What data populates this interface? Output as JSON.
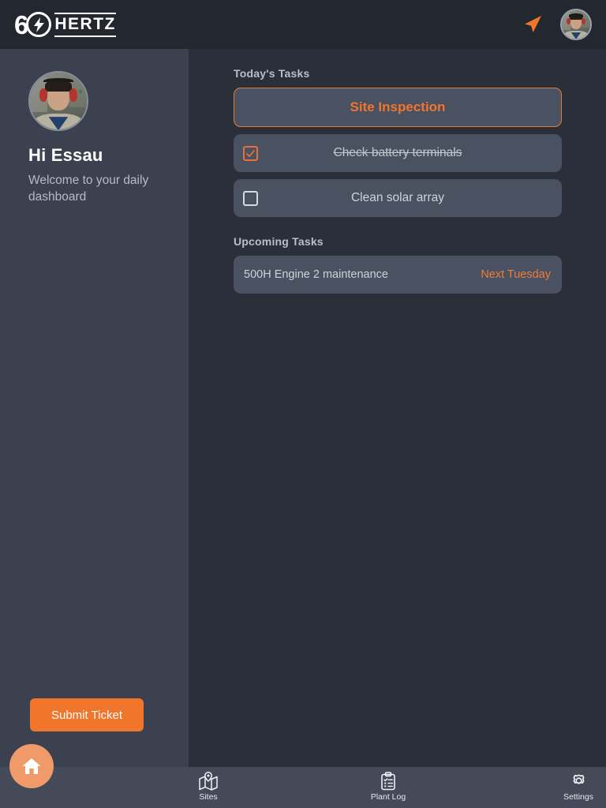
{
  "header": {
    "logo": {
      "six": "6",
      "word": "HERTZ",
      "bolt_icon": "lightning-bolt-icon"
    },
    "send_icon": "send-arrow-icon",
    "avatar": "user-avatar"
  },
  "sidebar": {
    "avatar": "profile-avatar",
    "greeting": "Hi Essau",
    "welcome": "Welcome to your daily dashboard",
    "submit_ticket_label": "Submit Ticket"
  },
  "main": {
    "todays_tasks_title": "Today's Tasks",
    "primary_task": "Site Inspection",
    "tasks": [
      {
        "label": "Check battery terminals",
        "checked": true
      },
      {
        "label": "Clean solar array",
        "checked": false
      }
    ],
    "upcoming_tasks_title": "Upcoming Tasks",
    "upcoming": [
      {
        "name": "500H Engine 2 maintenance",
        "when": "Next Tuesday"
      }
    ]
  },
  "bottom_nav": {
    "items": [
      {
        "label": "Sites",
        "icon": "map-pin-icon"
      },
      {
        "label": "Plant Log",
        "icon": "clipboard-checklist-icon"
      },
      {
        "label": "Settings",
        "icon": "gear-icon"
      }
    ],
    "fab": {
      "icon": "home-icon"
    }
  },
  "colors": {
    "accent_orange": "#f1752b",
    "accent_orange_light": "#ef9a68",
    "header_bg": "#232730",
    "sidebar_bg": "#3b414e",
    "main_bg": "#2b2f3a",
    "card_bg": "#4a5160",
    "nav_bg": "#444a57"
  }
}
